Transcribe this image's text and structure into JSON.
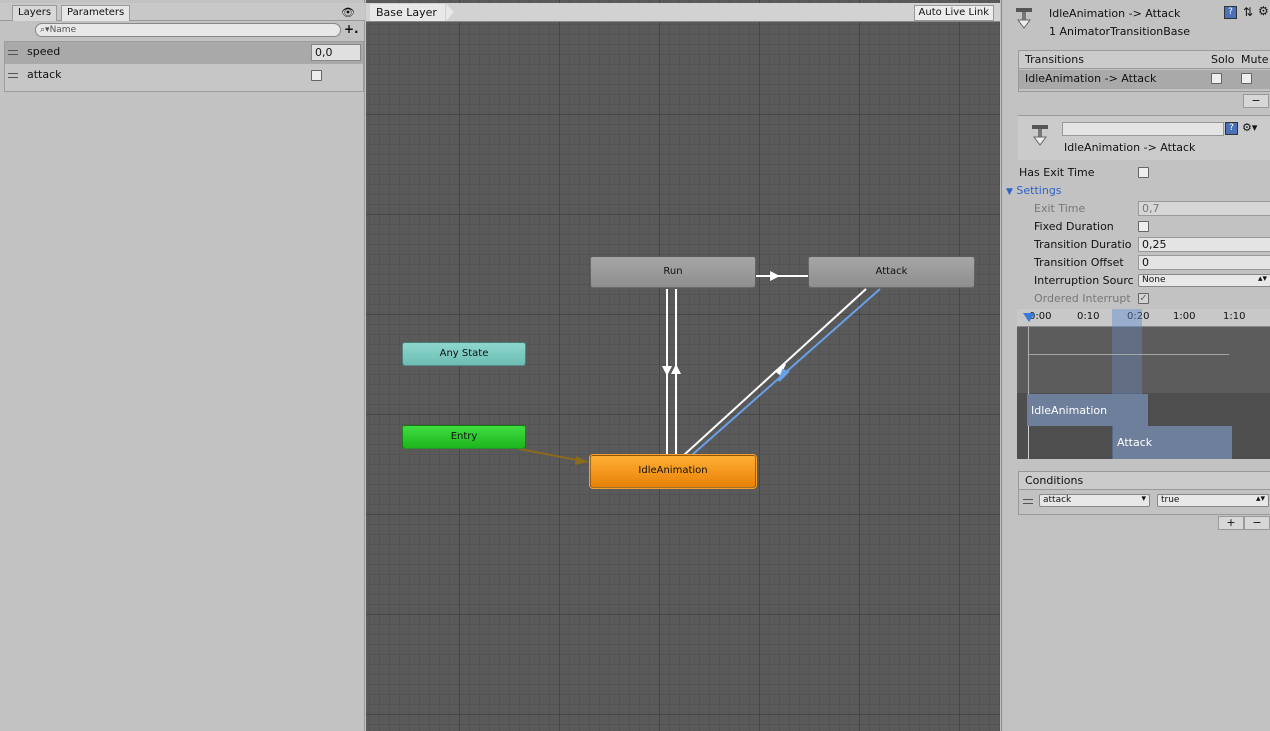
{
  "left_panel": {
    "tabs": [
      "Layers",
      "Parameters"
    ],
    "search_placeholder": "Name",
    "parameters": [
      {
        "name": "speed",
        "value": "0,0",
        "type": "float"
      },
      {
        "name": "attack",
        "value": "",
        "type": "trigger"
      }
    ]
  },
  "graph": {
    "breadcrumb": "Base Layer",
    "auto_live_link": "Auto Live Link",
    "nodes": {
      "run": "Run",
      "attack": "Attack",
      "any_state": "Any State",
      "entry": "Entry",
      "idle": "IdleAnimation"
    }
  },
  "inspector": {
    "title": "IdleAnimation -> Attack",
    "subtitle": "1 AnimatorTransitionBase",
    "transitions_header": "Transitions",
    "solo_label": "Solo",
    "mute_label": "Mute",
    "transition_row": "IdleAnimation -> Attack",
    "remove_label": "−",
    "name_field_value": "",
    "transition_name": "IdleAnimation -> Attack",
    "has_exit_time_label": "Has Exit Time",
    "settings_label": "Settings",
    "settings": {
      "exit_time_label": "Exit Time",
      "exit_time_value": "0,7",
      "fixed_duration_label": "Fixed Duration",
      "transition_duration_label": "Transition Duratio",
      "transition_duration_value": "0,25",
      "transition_offset_label": "Transition Offset",
      "transition_offset_value": "0",
      "interruption_source_label": "Interruption Sourc",
      "interruption_source_value": "None",
      "ordered_interrupt_label": "Ordered Interrupt"
    },
    "timeline": {
      "ticks": [
        "0:00",
        "0:10",
        "0:20",
        "1:00",
        "1:10"
      ],
      "from_state": "IdleAnimation",
      "to_state": "Attack"
    },
    "conditions_header": "Conditions",
    "condition": {
      "parameter": "attack",
      "value": "true"
    },
    "add_label": "+",
    "remove_cond_label": "−"
  },
  "colors": {
    "graph_bg": "#5a5a5a",
    "selected_transition": "#6aa0e8",
    "entry_node": "#2ccb2c",
    "idle_node": "#f49a1e",
    "any_state_node": "#7ccac1"
  }
}
